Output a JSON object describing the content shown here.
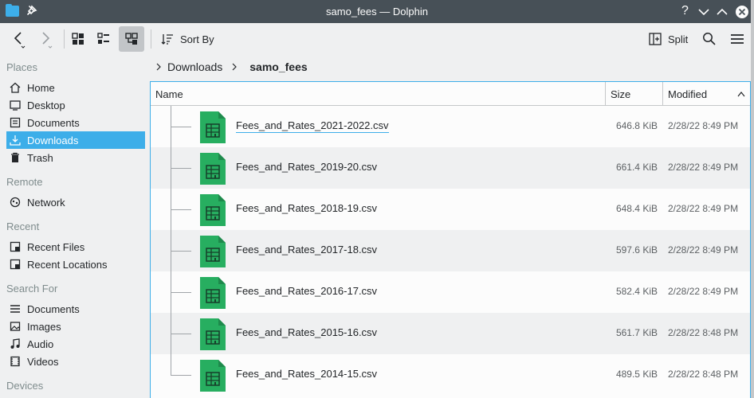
{
  "window": {
    "title": "samo_fees — Dolphin",
    "help": "?",
    "colors": {
      "titlebar": "#475057",
      "accent": "#3daee9",
      "csv_icon": "#27ae60"
    }
  },
  "toolbar": {
    "back": "back-arrow",
    "forward": "forward-arrow",
    "sort_label": "Sort By",
    "split_label": "Split"
  },
  "sidebar": {
    "places_heading": "Places",
    "places": [
      {
        "label": "Home",
        "icon": "home-icon"
      },
      {
        "label": "Desktop",
        "icon": "desktop-icon"
      },
      {
        "label": "Documents",
        "icon": "documents-icon"
      },
      {
        "label": "Downloads",
        "icon": "downloads-icon",
        "selected": true
      },
      {
        "label": "Trash",
        "icon": "trash-icon"
      }
    ],
    "remote_heading": "Remote",
    "remote": [
      {
        "label": "Network",
        "icon": "network-icon"
      }
    ],
    "recent_heading": "Recent",
    "recent": [
      {
        "label": "Recent Files",
        "icon": "recent-files-icon"
      },
      {
        "label": "Recent Locations",
        "icon": "recent-locations-icon"
      }
    ],
    "search_heading": "Search For",
    "search": [
      {
        "label": "Documents",
        "icon": "documents-icon"
      },
      {
        "label": "Images",
        "icon": "images-icon"
      },
      {
        "label": "Audio",
        "icon": "audio-icon"
      },
      {
        "label": "Videos",
        "icon": "videos-icon"
      }
    ],
    "devices_heading": "Devices"
  },
  "breadcrumb": {
    "parent": "Downloads",
    "current": "samo_fees"
  },
  "columns": {
    "name": "Name",
    "size": "Size",
    "modified": "Modified"
  },
  "files": [
    {
      "name": "Fees_and_Rates_2021-2022.csv",
      "size": "646.8 KiB",
      "modified": "2/28/22 8:49 PM"
    },
    {
      "name": "Fees_and_Rates_2019-20.csv",
      "size": "661.4 KiB",
      "modified": "2/28/22 8:49 PM"
    },
    {
      "name": "Fees_and_Rates_2018-19.csv",
      "size": "648.4 KiB",
      "modified": "2/28/22 8:49 PM"
    },
    {
      "name": "Fees_and_Rates_2017-18.csv",
      "size": "597.6 KiB",
      "modified": "2/28/22 8:49 PM"
    },
    {
      "name": "Fees_and_Rates_2016-17.csv",
      "size": "582.4 KiB",
      "modified": "2/28/22 8:49 PM"
    },
    {
      "name": "Fees_and_Rates_2015-16.csv",
      "size": "561.7 KiB",
      "modified": "2/28/22 8:48 PM"
    },
    {
      "name": "Fees_and_Rates_2014-15.csv",
      "size": "489.5 KiB",
      "modified": "2/28/22 8:48 PM"
    }
  ]
}
